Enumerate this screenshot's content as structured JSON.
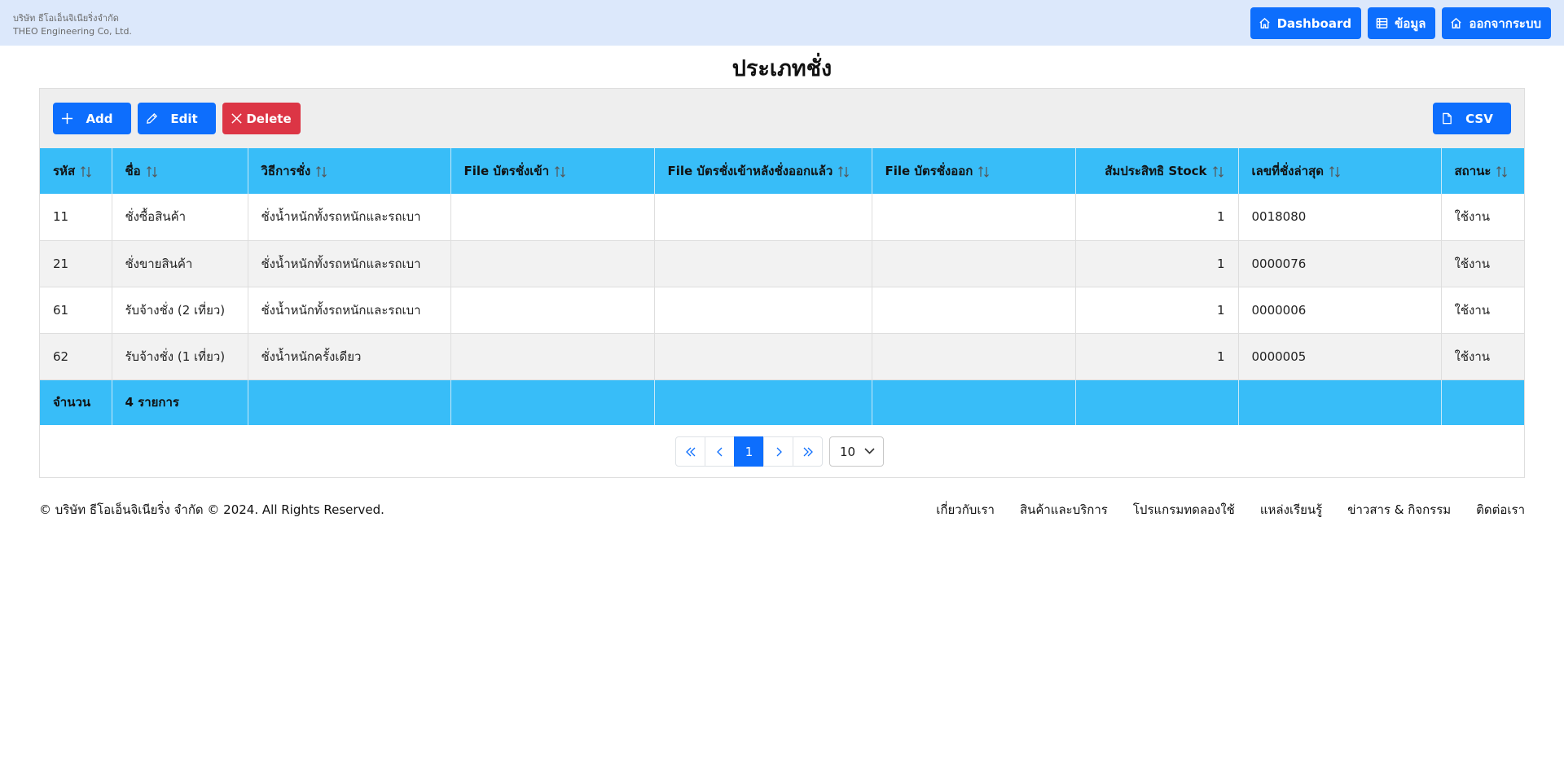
{
  "header": {
    "company_th": "บริษัท ธีโอเอ็นจิเนียริ่งจำกัด",
    "company_en": "THEO Engineering Co, Ltd.",
    "nav": [
      {
        "label": "Dashboard",
        "icon": "home-icon"
      },
      {
        "label": "ข้อมูล",
        "icon": "list-icon"
      },
      {
        "label": "ออกจากระบบ",
        "icon": "home-icon"
      }
    ]
  },
  "page": {
    "title": "ประเภทชั่ง"
  },
  "toolbar": {
    "add_label": "Add",
    "edit_label": "Edit",
    "delete_label": "Delete",
    "csv_label": "CSV"
  },
  "table": {
    "columns": [
      "รหัส",
      "ชื่อ",
      "วิธีการชั่ง",
      "File บัตรชั่งเข้า",
      "File บัตรชั่งเข้าหลังชั่งออกแล้ว",
      "File บัตรชั่งออก",
      "สัมประสิทธิ Stock",
      "เลขที่ชั่งล่าสุด",
      "สถานะ"
    ],
    "rows": [
      [
        "11",
        "ชั่งซื้อสินค้า",
        "ชั่งน้ำหนักทั้งรถหนักและรถเบา",
        "",
        "",
        "",
        "1",
        "0018080",
        "ใช้งาน"
      ],
      [
        "21",
        "ชั่งขายสินค้า",
        "ชั่งน้ำหนักทั้งรถหนักและรถเบา",
        "",
        "",
        "",
        "1",
        "0000076",
        "ใช้งาน"
      ],
      [
        "61",
        "รับจ้างชั่ง (2 เที่ยว)",
        "ชั่งน้ำหนักทั้งรถหนักและรถเบา",
        "",
        "",
        "",
        "1",
        "0000006",
        "ใช้งาน"
      ],
      [
        "62",
        "รับจ้างชั่ง (1 เที่ยว)",
        "ชั่งน้ำหนักครั้งเดียว",
        "",
        "",
        "",
        "1",
        "0000005",
        "ใช้งาน"
      ]
    ],
    "footer_label": "จำนวน",
    "footer_count": "4 รายการ"
  },
  "pagination": {
    "first": "«",
    "prev": "‹",
    "current": "1",
    "next": "›",
    "last": "»",
    "page_size": "10"
  },
  "footer": {
    "copyright": "© บริษัท ธีโอเอ็นจิเนียริ่ง จำกัด © 2024. All Rights Reserved.",
    "links": [
      "เกี่ยวกับเรา",
      "สินค้าและบริการ",
      "โปรแกรมทดลองใช้",
      "แหล่งเรียนรู้",
      "ข่าวสาร & กิจกรรม",
      "ติดต่อเรา"
    ]
  },
  "colors": {
    "topbar": "#dce8fb",
    "primary": "#0d6efd",
    "danger": "#dc3545",
    "table_header": "#38bdf8"
  }
}
